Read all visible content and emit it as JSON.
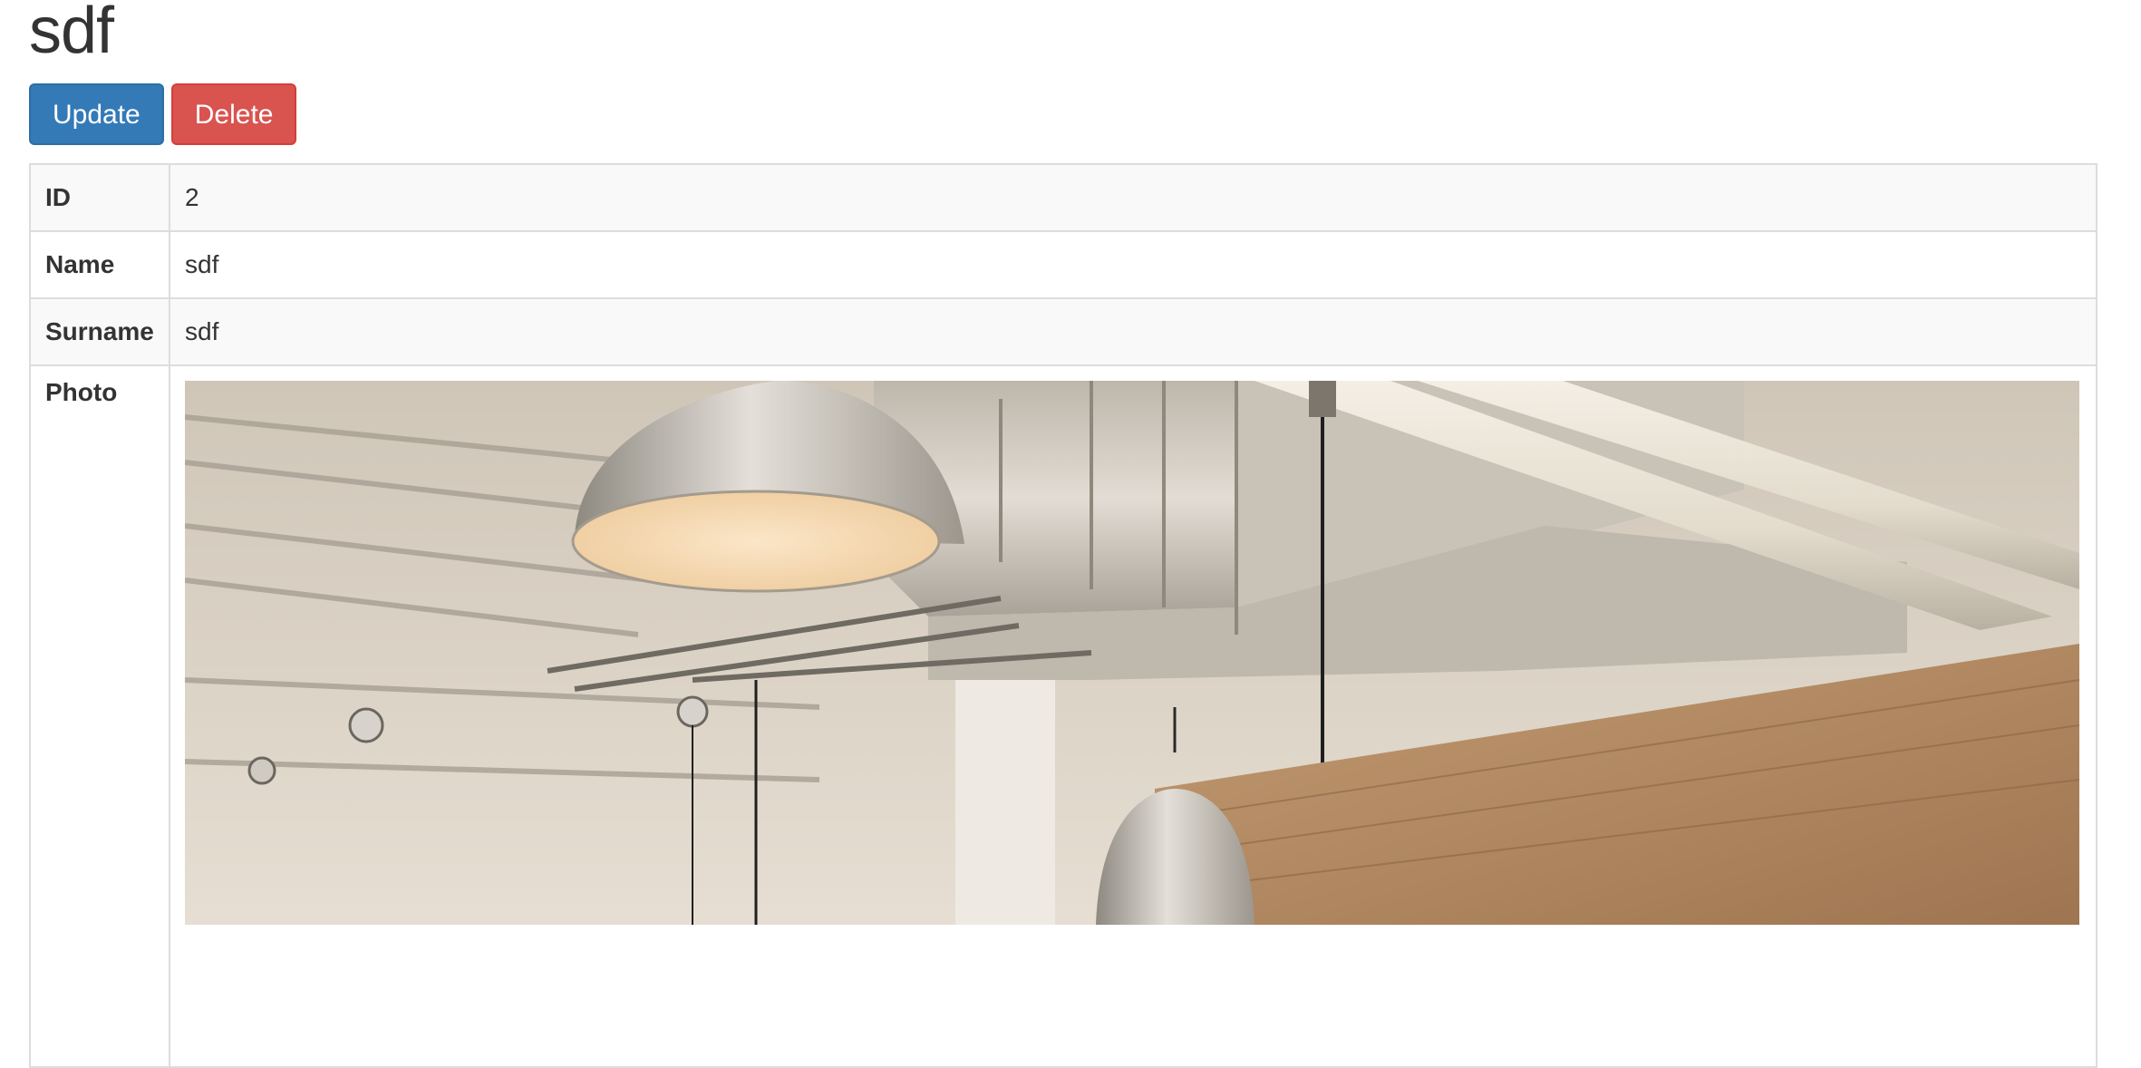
{
  "record": {
    "title": "sdf"
  },
  "actions": {
    "update_label": "Update",
    "delete_label": "Delete"
  },
  "details": {
    "id": {
      "label": "ID",
      "value": "2"
    },
    "name": {
      "label": "Name",
      "value": "sdf"
    },
    "surname": {
      "label": "Surname",
      "value": "sdf"
    },
    "photo": {
      "label": "Photo"
    }
  },
  "colors": {
    "primary": "#337ab7",
    "danger": "#d9534f",
    "border": "#dddddd",
    "stripe": "#f9f9f9"
  }
}
